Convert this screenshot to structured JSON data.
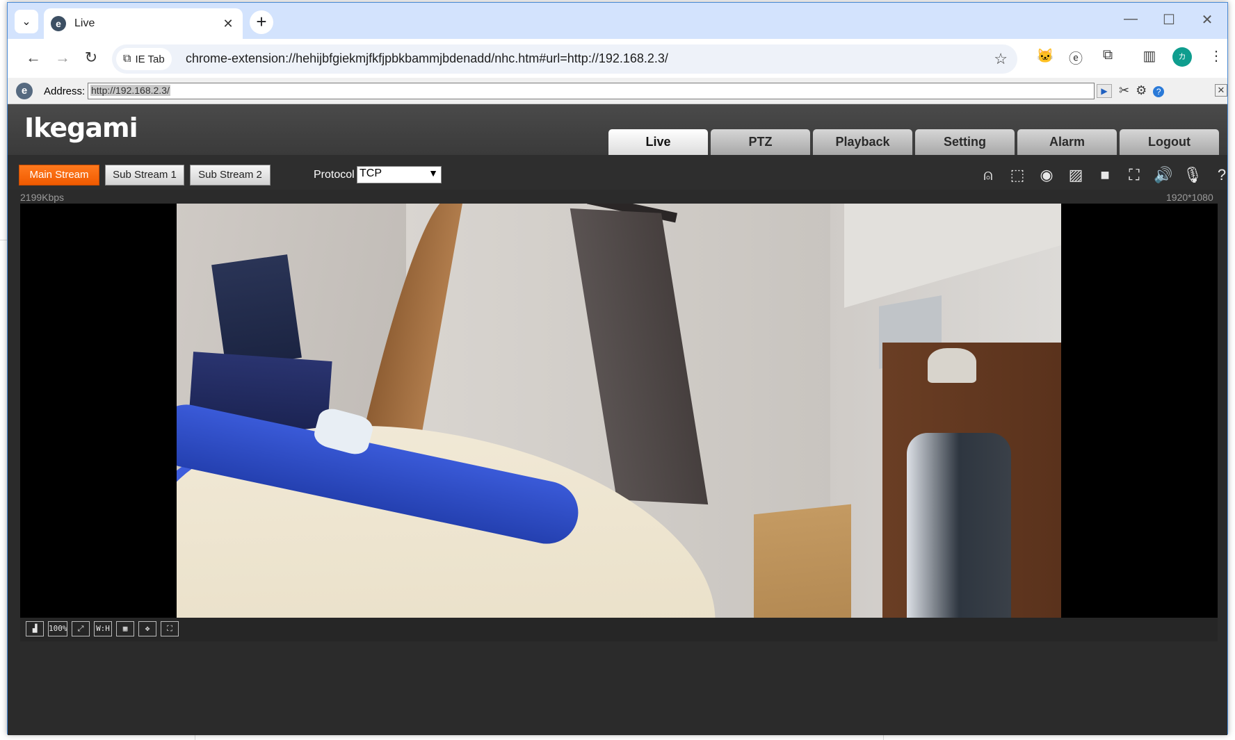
{
  "browser": {
    "tab_title": "Live",
    "url": "chrome-extension://hehijbfgiekmjfkfjpbkbammjbdenadd/nhc.htm#url=http://192.168.2.3/",
    "ietab_label": "IE Tab",
    "avatar_letter": "カ",
    "icons": {
      "tab_search": "chevron-down-icon",
      "tab_favicon": "ie-icon",
      "tab_close": "close-icon",
      "new_tab": "plus-icon",
      "minimize": "minimize-icon",
      "maximize": "maximize-icon",
      "close": "close-icon",
      "back": "back-arrow-icon",
      "forward": "forward-arrow-icon",
      "reload": "reload-icon",
      "bookmark": "star-icon",
      "extensions": "puzzle-icon",
      "side_panel": "side-panel-icon",
      "menu": "kebab-menu-icon"
    }
  },
  "iebar": {
    "address_label": "Address:",
    "address_value": "http://192.168.2.3/"
  },
  "app": {
    "logo": "Ikegami",
    "nav_tabs": [
      {
        "label": "Live",
        "active": true
      },
      {
        "label": "PTZ",
        "active": false
      },
      {
        "label": "Playback",
        "active": false
      },
      {
        "label": "Setting",
        "active": false
      },
      {
        "label": "Alarm",
        "active": false
      },
      {
        "label": "Logout",
        "active": false
      }
    ],
    "streams": {
      "main": "Main Stream",
      "sub1": "Sub Stream 1",
      "sub2": "Sub Stream 2",
      "active": "main"
    },
    "protocol": {
      "label": "Protocol",
      "value": "TCP"
    },
    "bitrate": "2199Kbps",
    "resolution": "1920*1080",
    "video_toolbar": {
      "zoom_label": "100%",
      "wh_label": "W:H"
    },
    "colors": {
      "accent_orange": "#f05a00",
      "header_bg": "#3a3a3a"
    }
  }
}
